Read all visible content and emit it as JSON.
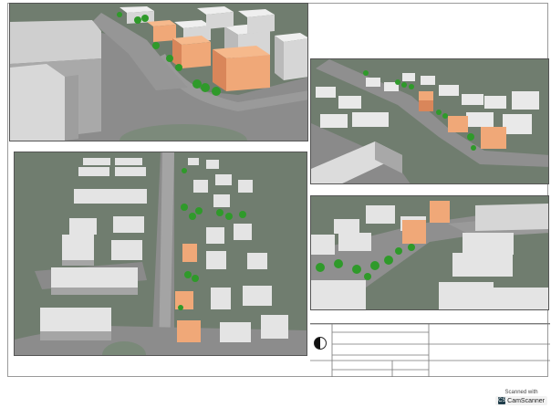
{
  "scanner": {
    "line1": "Scanned with",
    "app": "CamScanner",
    "icon": "camscanner-icon"
  },
  "colors": {
    "ground": "#6f7c6e",
    "building": "#e6e6e6",
    "building_side": "#bdbdbd",
    "highlight": "#f0a878",
    "highlight_side": "#d9865a",
    "tree": "#2f9a2a",
    "road": "#8a8a8a"
  }
}
